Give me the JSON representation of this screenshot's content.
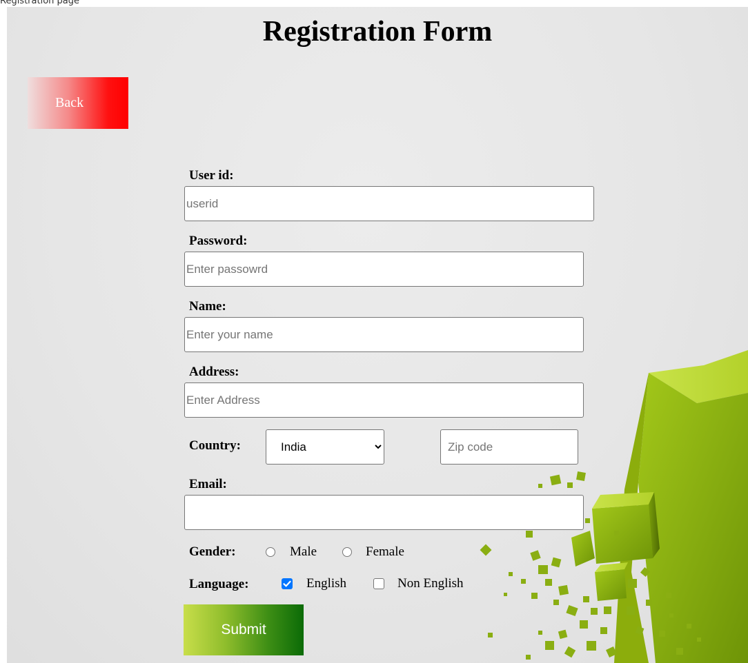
{
  "caption": "Registration page",
  "page_title": "Registration Form",
  "back_label": "Back",
  "fields": {
    "userid": {
      "label": "User id:",
      "placeholder": "userid",
      "value": ""
    },
    "password": {
      "label": "Password:",
      "placeholder": "Enter passowrd",
      "value": ""
    },
    "name": {
      "label": "Name:",
      "placeholder": "Enter your name",
      "value": ""
    },
    "address": {
      "label": "Address:",
      "placeholder": "Enter Address",
      "value": ""
    },
    "country": {
      "label": "Country:",
      "selected": "India"
    },
    "zip": {
      "placeholder": "Zip code",
      "value": ""
    },
    "email": {
      "label": "Email:",
      "placeholder": "",
      "value": ""
    }
  },
  "gender": {
    "label": "Gender:",
    "options": [
      {
        "label": "Male",
        "checked": false
      },
      {
        "label": "Female",
        "checked": false
      }
    ]
  },
  "language": {
    "label": "Language:",
    "options": [
      {
        "label": "English",
        "checked": true
      },
      {
        "label": "Non English",
        "checked": false
      }
    ]
  },
  "submit_label": "Submit",
  "colors": {
    "back_button": "#ff0000",
    "submit_button": "#0b6b07",
    "checkbox_accent": "#0075ff",
    "cube_green": "#8db40e"
  },
  "icons": {
    "select_arrow": "chevron-down-icon",
    "checkbox_mark": "checkmark-icon"
  }
}
